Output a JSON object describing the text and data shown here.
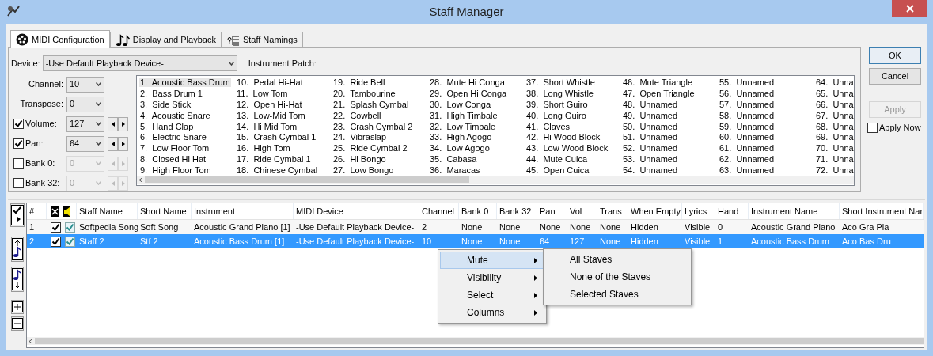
{
  "window": {
    "title": "Staff Manager"
  },
  "tabs": [
    {
      "label": "MIDI Configuration",
      "selected": true,
      "kind": "midi"
    },
    {
      "label": "Display and Playback",
      "selected": false,
      "kind": "notes"
    },
    {
      "label": "Staff Namings",
      "selected": false,
      "kind": "names"
    }
  ],
  "device": {
    "label": "Device:",
    "value": "-Use Default Playback Device-"
  },
  "settings": [
    {
      "label": "Channel:",
      "value": "10",
      "kind": "plain"
    },
    {
      "label": "Transpose:",
      "value": "0",
      "kind": "plain"
    },
    {
      "label": "Volume:",
      "value": "127",
      "kind": "check",
      "checked": true,
      "disabled": false
    },
    {
      "label": "Pan:",
      "value": "64",
      "kind": "check",
      "checked": true,
      "disabled": false
    },
    {
      "label": "Bank 0:",
      "value": "0",
      "kind": "check",
      "checked": false,
      "disabled": true
    },
    {
      "label": "Bank 32:",
      "value": "0",
      "kind": "check",
      "checked": false,
      "disabled": true
    }
  ],
  "instrument_patch": {
    "label": "Instrument Patch:",
    "items": [
      {
        "text": "1.  Acoustic Bass Drum",
        "selected": true
      },
      {
        "text": "2.  Bass Drum 1",
        "selected": false
      },
      {
        "text": "3.  Side Stick",
        "selected": false
      },
      {
        "text": "4.  Acoustic Snare",
        "selected": false
      },
      {
        "text": "5.  Hand Clap",
        "selected": false
      },
      {
        "text": "6.  Electric Snare",
        "selected": false
      },
      {
        "text": "7.  Low Floor Tom",
        "selected": false
      },
      {
        "text": "8.  Closed Hi Hat",
        "selected": false
      },
      {
        "text": "9.  High Floor Tom",
        "selected": false
      },
      {
        "text": "10.  Pedal Hi-Hat",
        "selected": false
      },
      {
        "text": "11.  Low Tom",
        "selected": false
      },
      {
        "text": "12.  Open Hi-Hat",
        "selected": false
      },
      {
        "text": "13.  Low-Mid Tom",
        "selected": false
      },
      {
        "text": "14.  Hi Mid Tom",
        "selected": false
      },
      {
        "text": "15.  Crash Cymbal 1",
        "selected": false
      },
      {
        "text": "16.  High Tom",
        "selected": false
      },
      {
        "text": "17.  Ride Cymbal 1",
        "selected": false
      },
      {
        "text": "18.  Chinese Cymbal",
        "selected": false
      },
      {
        "text": "19.  Ride Bell",
        "selected": false
      },
      {
        "text": "20.  Tambourine",
        "selected": false
      },
      {
        "text": "21.  Splash Cymbal",
        "selected": false
      },
      {
        "text": "22.  Cowbell",
        "selected": false
      },
      {
        "text": "23.  Crash Cymbal 2",
        "selected": false
      },
      {
        "text": "24.  Vibraslap",
        "selected": false
      },
      {
        "text": "25.  Ride Cymbal 2",
        "selected": false
      },
      {
        "text": "26.  Hi Bongo",
        "selected": false
      },
      {
        "text": "27.  Low Bongo",
        "selected": false
      },
      {
        "text": "28.  Mute Hi Conga",
        "selected": false
      },
      {
        "text": "29.  Open Hi Conga",
        "selected": false
      },
      {
        "text": "30.  Low Conga",
        "selected": false
      },
      {
        "text": "31.  High Timbale",
        "selected": false
      },
      {
        "text": "32.  Low Timbale",
        "selected": false
      },
      {
        "text": "33.  High Agogo",
        "selected": false
      },
      {
        "text": "34.  Low Agogo",
        "selected": false
      },
      {
        "text": "35.  Cabasa",
        "selected": false
      },
      {
        "text": "36.  Maracas",
        "selected": false
      },
      {
        "text": "37.  Short Whistle",
        "selected": false
      },
      {
        "text": "38.  Long Whistle",
        "selected": false
      },
      {
        "text": "39.  Short Guiro",
        "selected": false
      },
      {
        "text": "40.  Long Guiro",
        "selected": false
      },
      {
        "text": "41.  Claves",
        "selected": false
      },
      {
        "text": "42.  Hi Wood Block",
        "selected": false
      },
      {
        "text": "43.  Low Wood Block",
        "selected": false
      },
      {
        "text": "44.  Mute Cuica",
        "selected": false
      },
      {
        "text": "45.  Open Cuica",
        "selected": false
      },
      {
        "text": "46.  Mute Triangle",
        "selected": false
      },
      {
        "text": "47.  Open Triangle",
        "selected": false
      },
      {
        "text": "48.  Unnamed",
        "selected": false
      },
      {
        "text": "49.  Unnamed",
        "selected": false
      },
      {
        "text": "50.  Unnamed",
        "selected": false
      },
      {
        "text": "51.  Unnamed",
        "selected": false
      },
      {
        "text": "52.  Unnamed",
        "selected": false
      },
      {
        "text": "53.  Unnamed",
        "selected": false
      },
      {
        "text": "54.  Unnamed",
        "selected": false
      },
      {
        "text": "55.  Unnamed",
        "selected": false
      },
      {
        "text": "56.  Unnamed",
        "selected": false
      },
      {
        "text": "57.  Unnamed",
        "selected": false
      },
      {
        "text": "58.  Unnamed",
        "selected": false
      },
      {
        "text": "59.  Unnamed",
        "selected": false
      },
      {
        "text": "60.  Unnamed",
        "selected": false
      },
      {
        "text": "61.  Unnamed",
        "selected": false
      },
      {
        "text": "62.  Unnamed",
        "selected": false
      },
      {
        "text": "63.  Unnamed",
        "selected": false
      },
      {
        "text": "64.  Unna",
        "selected": false
      },
      {
        "text": "65.  Unna",
        "selected": false
      },
      {
        "text": "66.  Unna",
        "selected": false
      },
      {
        "text": "67.  Unna",
        "selected": false
      },
      {
        "text": "68.  Unna",
        "selected": false
      },
      {
        "text": "69.  Unna",
        "selected": false
      },
      {
        "text": "70.  Unna",
        "selected": false
      },
      {
        "text": "71.  Unna",
        "selected": false
      },
      {
        "text": "72.  Unna",
        "selected": false
      }
    ]
  },
  "buttons": [
    {
      "label": "OK",
      "kind": "default",
      "disabled": false
    },
    {
      "label": "Cancel",
      "kind": "normal",
      "disabled": false
    },
    {
      "label": "Apply",
      "kind": "normal",
      "disabled": true
    }
  ],
  "apply_now": {
    "label": "Apply Now",
    "checked": false
  },
  "staff_table": {
    "columns": [
      "#",
      "",
      "Staff Name",
      "Short Name",
      "Instrument",
      "MIDI Device",
      "Channel",
      "Bank 0",
      "Bank 32",
      "Pan",
      "Vol",
      "Trans",
      "When Empty",
      "Lyrics",
      "Hand",
      "Instrument Name",
      "Short Instrument Nar"
    ],
    "rows": [
      {
        "selected": false,
        "checked": true,
        "sound_checked": true,
        "cells": [
          "1",
          "",
          "Softpedia Song",
          "Soft Song",
          "Acoustic Grand Piano [1]",
          "-Use Default Playback Device-",
          "2",
          "None",
          "None",
          "None",
          "None",
          "None",
          "Hidden",
          "Visible",
          "0",
          "Acoustic Grand Piano",
          "Aco Gra Pia"
        ]
      },
      {
        "selected": true,
        "checked": true,
        "sound_checked": true,
        "cells": [
          "2",
          "",
          "Staff 2",
          "Stf 2",
          "Acoustic Bass Drum [1]",
          "-Use Default Playback Device-",
          "10",
          "None",
          "None",
          "64",
          "127",
          "None",
          "Hidden",
          "Visible",
          "1",
          "Acoustic Bass Drum",
          "Aco Bas Dru"
        ]
      }
    ]
  },
  "context_menu": {
    "items": [
      {
        "label": "Mute",
        "selected": true
      },
      {
        "label": "Visibility",
        "selected": false
      },
      {
        "label": "Select",
        "selected": false
      },
      {
        "label": "Columns",
        "selected": false
      }
    ]
  },
  "submenu": {
    "items": [
      {
        "label": "All Staves"
      },
      {
        "label": "None of the Staves"
      },
      {
        "label": "Selected Staves"
      }
    ]
  }
}
